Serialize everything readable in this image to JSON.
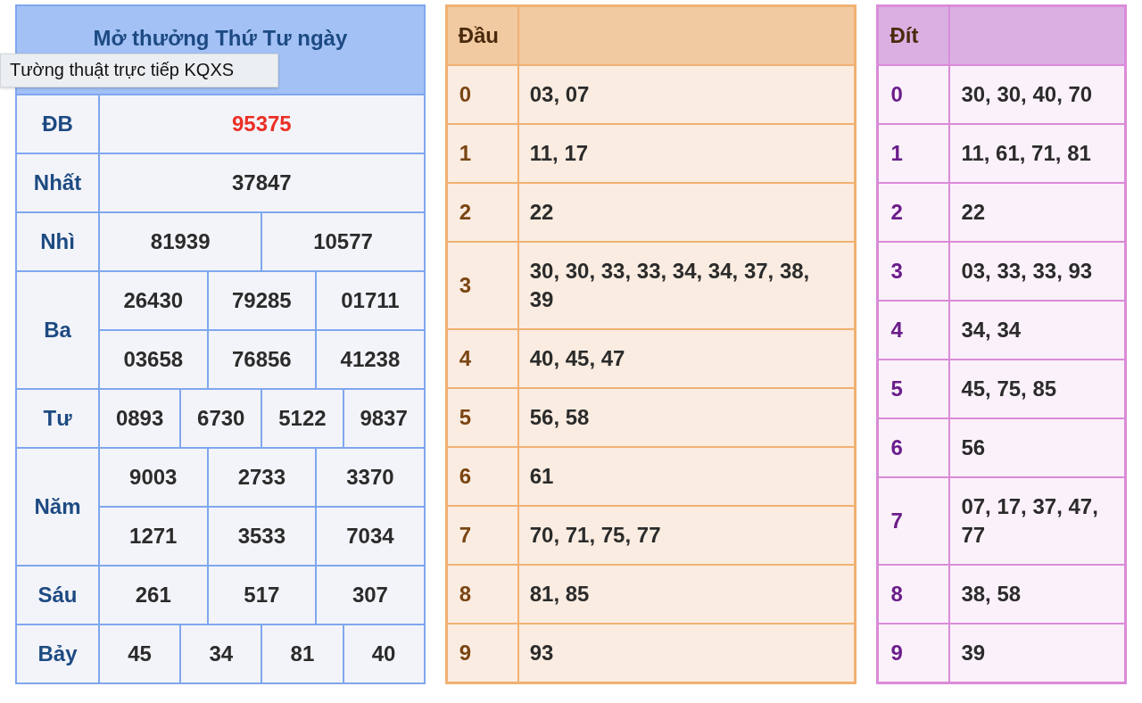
{
  "results": {
    "title": "Mở thưởng Thứ Tư ngày",
    "prizes": [
      {
        "name": "ĐB",
        "special": true,
        "lines": [
          [
            "95375"
          ]
        ]
      },
      {
        "name": "Nhất",
        "special": false,
        "lines": [
          [
            "37847"
          ]
        ]
      },
      {
        "name": "Nhì",
        "special": false,
        "lines": [
          [
            "81939",
            "10577"
          ]
        ]
      },
      {
        "name": "Ba",
        "special": false,
        "lines": [
          [
            "26430",
            "79285",
            "01711"
          ],
          [
            "03658",
            "76856",
            "41238"
          ]
        ]
      },
      {
        "name": "Tư",
        "special": false,
        "lines": [
          [
            "0893",
            "6730",
            "5122",
            "9837"
          ]
        ]
      },
      {
        "name": "Năm",
        "special": false,
        "lines": [
          [
            "9003",
            "2733",
            "3370"
          ],
          [
            "1271",
            "3533",
            "7034"
          ]
        ]
      },
      {
        "name": "Sáu",
        "special": false,
        "lines": [
          [
            "261",
            "517",
            "307"
          ]
        ]
      },
      {
        "name": "Bảy",
        "special": false,
        "lines": [
          [
            "45",
            "34",
            "81",
            "40"
          ]
        ]
      }
    ]
  },
  "tooltip": "Tường thuật trực tiếp KQXS",
  "dau": {
    "heading": "Đầu",
    "rows": [
      {
        "digit": "0",
        "numbers": "03, 07"
      },
      {
        "digit": "1",
        "numbers": "11, 17"
      },
      {
        "digit": "2",
        "numbers": "22"
      },
      {
        "digit": "3",
        "numbers": "30, 30, 33, 33, 34, 34, 37, 38, 39"
      },
      {
        "digit": "4",
        "numbers": "40, 45, 47"
      },
      {
        "digit": "5",
        "numbers": "56, 58"
      },
      {
        "digit": "6",
        "numbers": "61"
      },
      {
        "digit": "7",
        "numbers": "70, 71, 75, 77"
      },
      {
        "digit": "8",
        "numbers": "81, 85"
      },
      {
        "digit": "9",
        "numbers": "93"
      }
    ]
  },
  "dit": {
    "heading": "Đít",
    "rows": [
      {
        "digit": "0",
        "numbers": "30, 30, 40, 70"
      },
      {
        "digit": "1",
        "numbers": "11, 61, 71, 81"
      },
      {
        "digit": "2",
        "numbers": "22"
      },
      {
        "digit": "3",
        "numbers": "03, 33, 33, 93"
      },
      {
        "digit": "4",
        "numbers": "34, 34"
      },
      {
        "digit": "5",
        "numbers": "45, 75, 85"
      },
      {
        "digit": "6",
        "numbers": "56"
      },
      {
        "digit": "7",
        "numbers": "07, 17, 37, 47, 77"
      },
      {
        "digit": "8",
        "numbers": "38, 58"
      },
      {
        "digit": "9",
        "numbers": "39"
      }
    ]
  }
}
